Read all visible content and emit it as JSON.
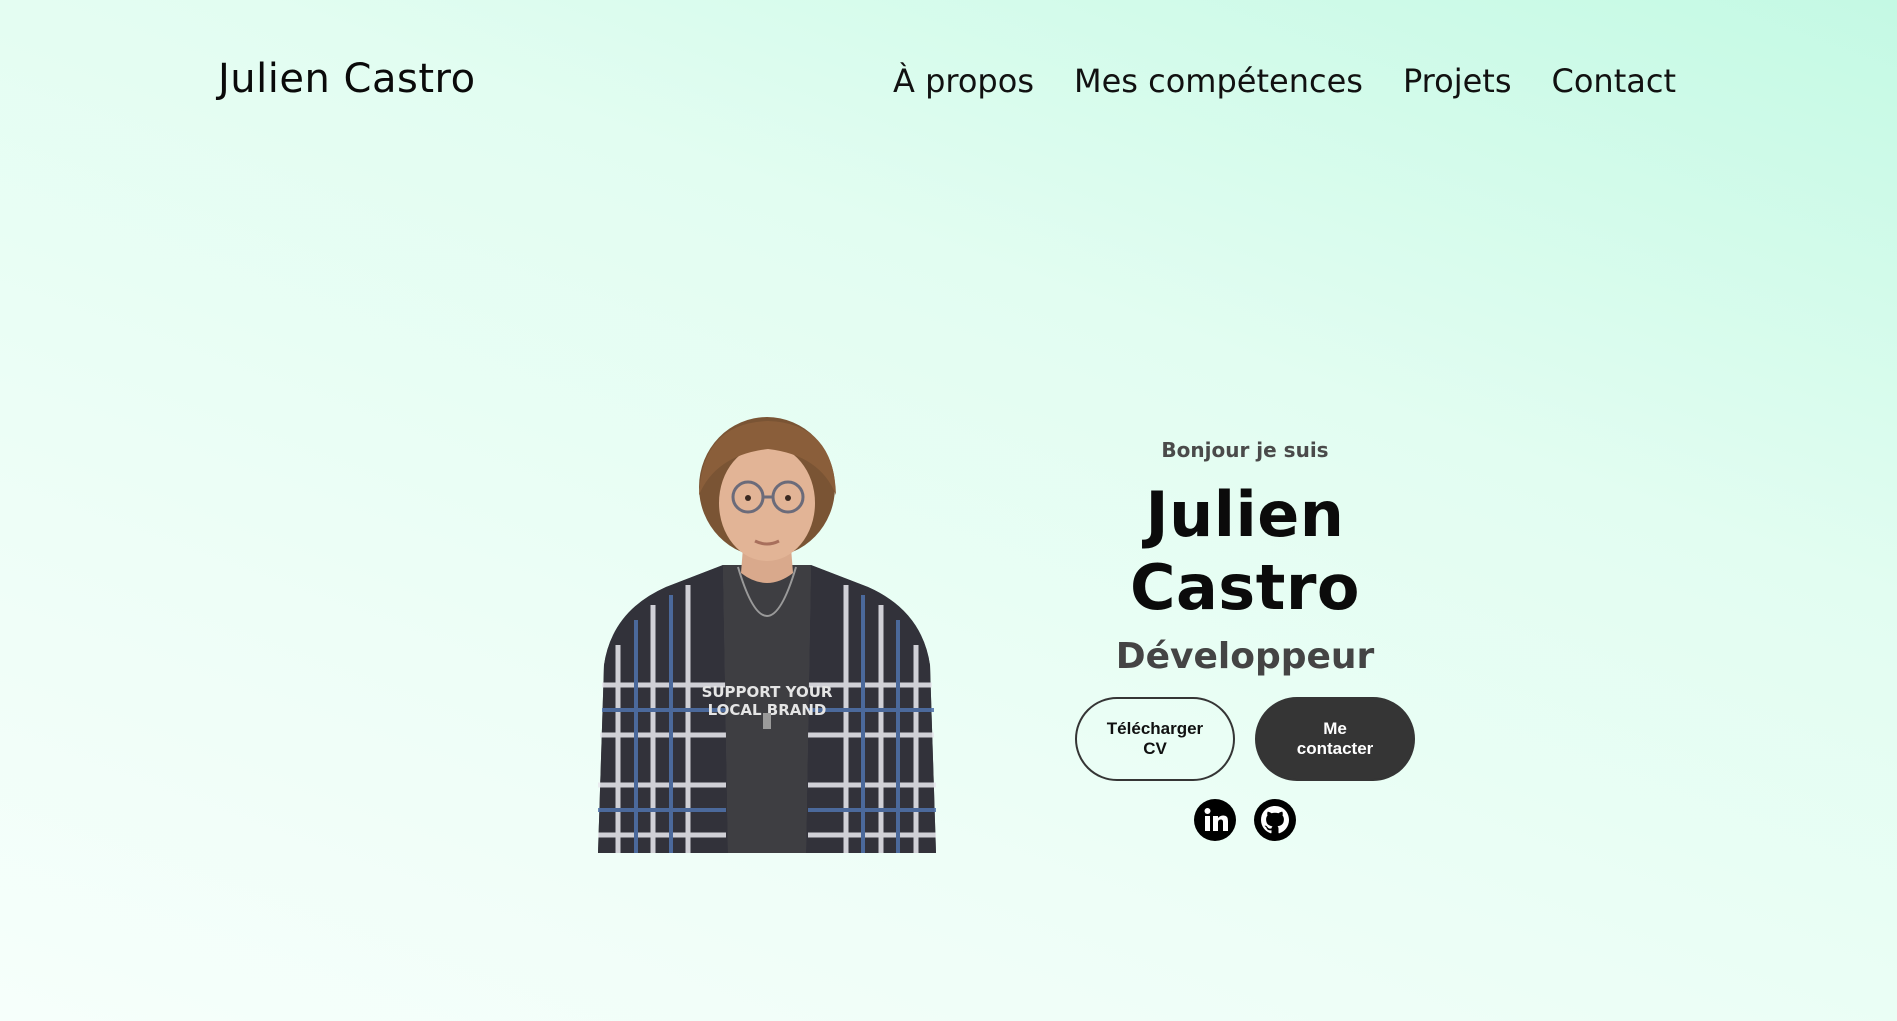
{
  "header": {
    "logo": "Julien Castro",
    "nav": [
      {
        "label": "À propos"
      },
      {
        "label": "Mes compétences"
      },
      {
        "label": "Projets"
      },
      {
        "label": "Contact"
      }
    ]
  },
  "hero": {
    "greeting": "Bonjour je suis",
    "name": "Julien Castro",
    "role": "Développeur",
    "photo_text": "SUPPORT YOUR LOCAL BRAND",
    "buttons": {
      "download_cv": "Télécharger CV",
      "contact": "Me contacter"
    },
    "socials": [
      {
        "icon": "linkedin-icon"
      },
      {
        "icon": "github-icon"
      }
    ]
  },
  "colors": {
    "background_top": "#c4f9e4",
    "background_bottom": "#f6fffb",
    "button_dark": "#353535",
    "text_dark": "#111111",
    "text_muted": "#444444"
  }
}
